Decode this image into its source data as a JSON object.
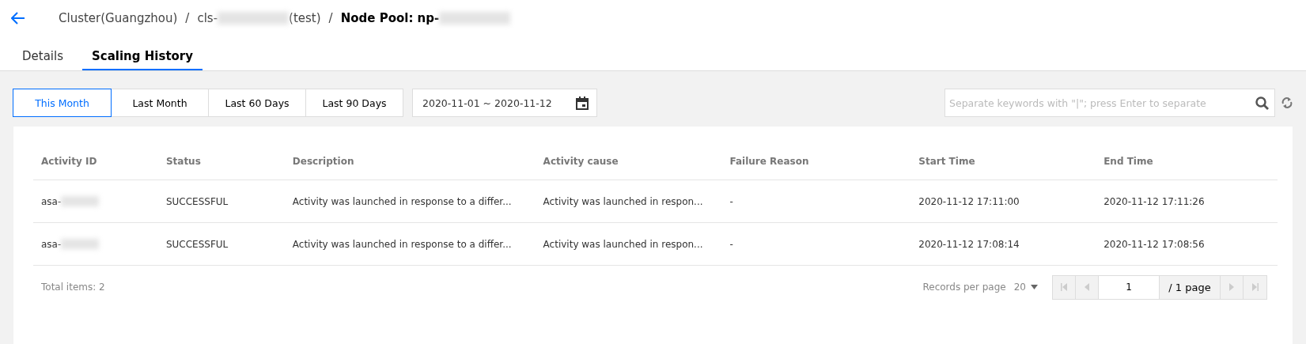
{
  "breadcrumb": {
    "items": [
      {
        "text": "Cluster(Guangzhou)",
        "kind": "link",
        "redacted": false,
        "separator": "/"
      },
      {
        "text": "cls-",
        "kind": "link",
        "redacted": true,
        "suffix": "(test)",
        "separator": "/"
      },
      {
        "text": "Node Pool: np-",
        "kind": "current",
        "redacted": true
      }
    ]
  },
  "tabs": [
    {
      "label": "Details",
      "selected": false
    },
    {
      "label": "Scaling History",
      "selected": true
    }
  ],
  "ranges": [
    {
      "label": "This Month",
      "selected": true
    },
    {
      "label": "Last Month",
      "selected": false
    },
    {
      "label": "Last 60 Days",
      "selected": false
    },
    {
      "label": "Last 90 Days",
      "selected": false
    }
  ],
  "date_range": {
    "value": "2020-11-01 ~ 2020-11-12"
  },
  "search": {
    "placeholder": "Separate keywords with \"|\"; press Enter to separate"
  },
  "table": {
    "columns": [
      "Activity ID",
      "Status",
      "Description",
      "Activity cause",
      "Failure Reason",
      "Start Time",
      "End Time"
    ],
    "rows": [
      {
        "cells": [
          "asa-",
          "SUCCESSFUL",
          "Activity was launched in response to a differ...",
          "Activity was launched in respon...",
          "-",
          "2020-11-12 17:11:00",
          "2020-11-12 17:11:26"
        ]
      },
      {
        "cells": [
          "asa-",
          "SUCCESSFUL",
          "Activity was launched in response to a differ...",
          "Activity was launched in respon...",
          "-",
          "2020-11-12 17:08:14",
          "2020-11-12 17:08:56"
        ]
      }
    ]
  },
  "footer": {
    "total_label": "Total items:",
    "total": "2",
    "per_page_label": "Records per page",
    "per_page": "20",
    "page": "1",
    "pages": "/ 1 page"
  }
}
